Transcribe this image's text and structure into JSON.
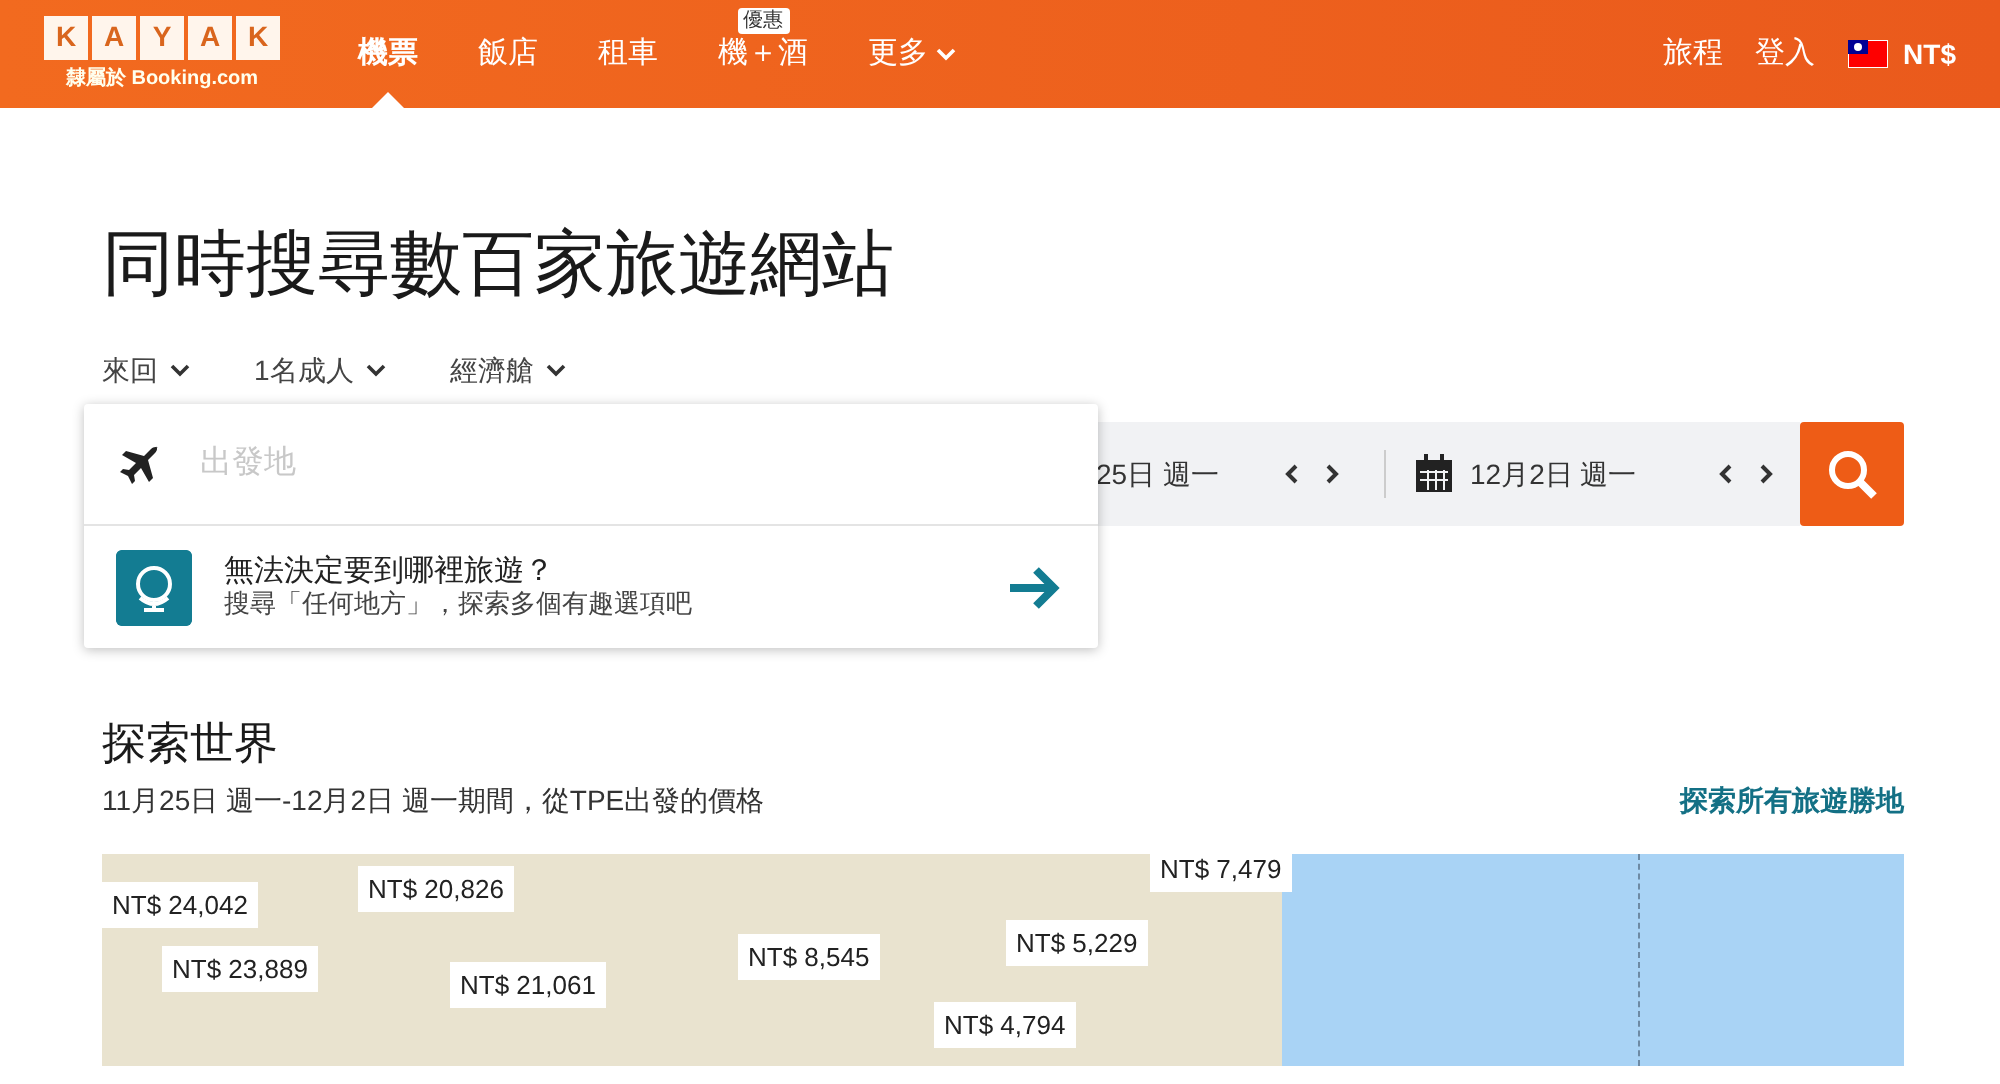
{
  "header": {
    "logo_letters": [
      "K",
      "A",
      "Y",
      "A",
      "K"
    ],
    "logo_tagline": "隸屬於 Booking.com",
    "nav": [
      {
        "label": "機票",
        "selected": true
      },
      {
        "label": "飯店",
        "selected": false
      },
      {
        "label": "租車",
        "selected": false
      },
      {
        "label": "機＋酒",
        "selected": false,
        "badge": "優惠"
      },
      {
        "label": "更多",
        "selected": false,
        "dropdown": true
      }
    ],
    "right_links": [
      "旅程",
      "登入"
    ],
    "currency": "NT$"
  },
  "title": "同時搜尋數百家旅遊網站",
  "options": [
    "來回",
    "1名成人",
    "經濟艙"
  ],
  "search": {
    "origin_placeholder": "出發地",
    "suggestion_title": "無法決定要到哪裡旅遊？",
    "suggestion_text": "搜尋「任何地方」，探索多個有趣選項吧",
    "depart_date": "25日 週一",
    "return_date": "12月2日 週一"
  },
  "explore": {
    "title": "探索世界",
    "subtitle": "11月25日 週一-12月2日 週一期間，從TPE出發的價格",
    "link": "探索所有旅遊勝地",
    "prices": [
      "NT$ 24,042",
      "NT$ 20,826",
      "NT$ 23,889",
      "NT$ 21,061",
      "NT$ 8,545",
      "NT$ 5,229",
      "NT$ 4,794",
      "NT$ 7,479"
    ]
  }
}
